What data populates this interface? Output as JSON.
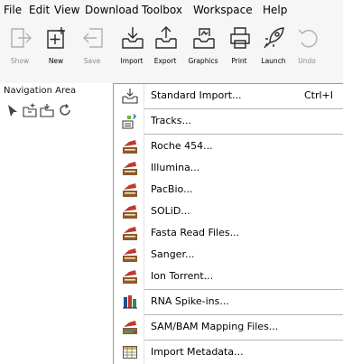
{
  "menubar": {
    "items": [
      "File",
      "Edit",
      "View",
      "Download",
      "Toolbox",
      "Workspace",
      "Help"
    ]
  },
  "toolbar": {
    "buttons": [
      {
        "label": "Show",
        "icon": "show-icon",
        "enabled": false
      },
      {
        "label": "New",
        "icon": "new-icon",
        "enabled": true
      },
      {
        "label": "Save",
        "icon": "save-icon",
        "enabled": false
      },
      {
        "label": "Import",
        "icon": "import-icon",
        "enabled": true
      },
      {
        "label": "Export",
        "icon": "export-icon",
        "enabled": true
      },
      {
        "label": "Graphics",
        "icon": "graphics-icon",
        "enabled": true
      },
      {
        "label": "Print",
        "icon": "print-icon",
        "enabled": true
      },
      {
        "label": "Launch",
        "icon": "launch-icon",
        "enabled": true
      },
      {
        "label": "Undo",
        "icon": "undo-icon",
        "enabled": false
      }
    ]
  },
  "navigation": {
    "title": "Navigation Area",
    "icons": [
      "filter-icon",
      "new-folder-icon",
      "import-folder-icon",
      "refresh-icon"
    ]
  },
  "import_menu": {
    "items": [
      {
        "label": "Standard Import...",
        "shortcut": "Ctrl+I",
        "icon": "import-icon"
      },
      {
        "label": "Tracks...",
        "shortcut": "",
        "icon": "tracks-icon"
      },
      {
        "label": "Roche 454...",
        "shortcut": "",
        "icon": "sequencer-icon"
      },
      {
        "label": "Illumina...",
        "shortcut": "",
        "icon": "sequencer-icon"
      },
      {
        "label": "PacBio...",
        "shortcut": "",
        "icon": "sequencer-icon"
      },
      {
        "label": "SOLiD...",
        "shortcut": "",
        "icon": "sequencer-icon"
      },
      {
        "label": "Fasta Read Files...",
        "shortcut": "",
        "icon": "sequencer-icon"
      },
      {
        "label": "Sanger...",
        "shortcut": "",
        "icon": "sequencer-icon"
      },
      {
        "label": "Ion Torrent...",
        "shortcut": "",
        "icon": "sequencer-icon"
      },
      {
        "label": "RNA Spike-ins...",
        "shortcut": "",
        "icon": "rna-spike-icon"
      },
      {
        "label": "SAM/BAM Mapping Files...",
        "shortcut": "",
        "icon": "mapping-icon"
      },
      {
        "label": "Import Metadata...",
        "shortcut": "",
        "icon": "metadata-icon"
      }
    ]
  },
  "colors": {
    "icon_stroke": "#2a2a2a",
    "disabled_icon": "#b0b0b0",
    "sequencer_red": "#c0392b",
    "sequencer_brown": "#8b5a2b"
  }
}
